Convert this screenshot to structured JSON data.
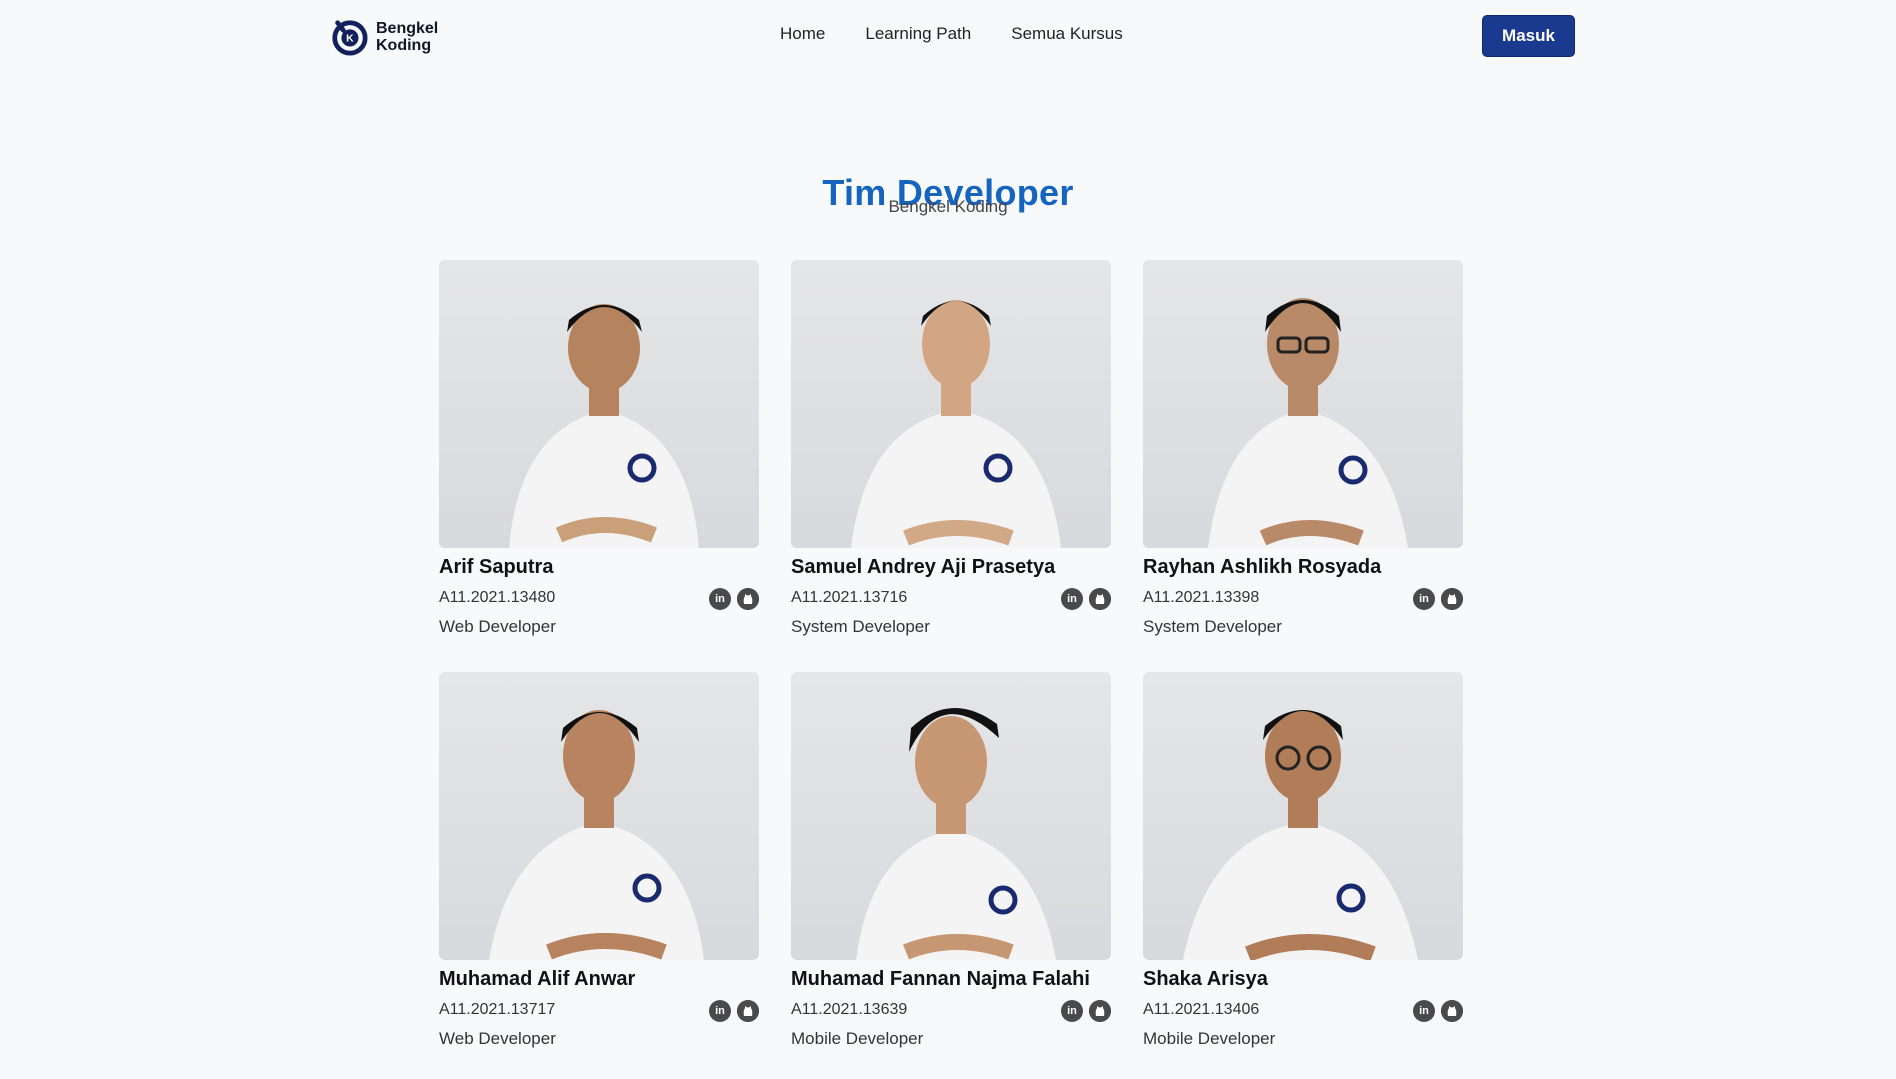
{
  "brand": {
    "line1": "Bengkel",
    "line2": "Koding",
    "accent": "#1a3a8f"
  },
  "nav": {
    "links": [
      "Home",
      "Learning Path",
      "Semua Kursus"
    ],
    "login_label": "Masuk"
  },
  "hero": {
    "title": "Tim Developer",
    "subtitle": "Bengkel Koding",
    "title_color": "#1565c0"
  },
  "members": [
    {
      "name": "Arif Saputra",
      "nim": "A11.2021.13480",
      "role": "Web Developer"
    },
    {
      "name": "Samuel Andrey Aji Prasetya",
      "nim": "A11.2021.13716",
      "role": "System Developer"
    },
    {
      "name": "Rayhan Ashlikh Rosyada",
      "nim": "A11.2021.13398",
      "role": "System Developer"
    },
    {
      "name": "Muhamad Alif Anwar",
      "nim": "A11.2021.13717",
      "role": "Web Developer"
    },
    {
      "name": "Muhamad Fannan Najma Falahi",
      "nim": "A11.2021.13639",
      "role": "Mobile Developer"
    },
    {
      "name": "Shaka Arisya",
      "nim": "A11.2021.13406",
      "role": "Mobile Developer"
    }
  ],
  "icons": {
    "social_1": "linkedin-icon",
    "social_2": "github-icon"
  }
}
